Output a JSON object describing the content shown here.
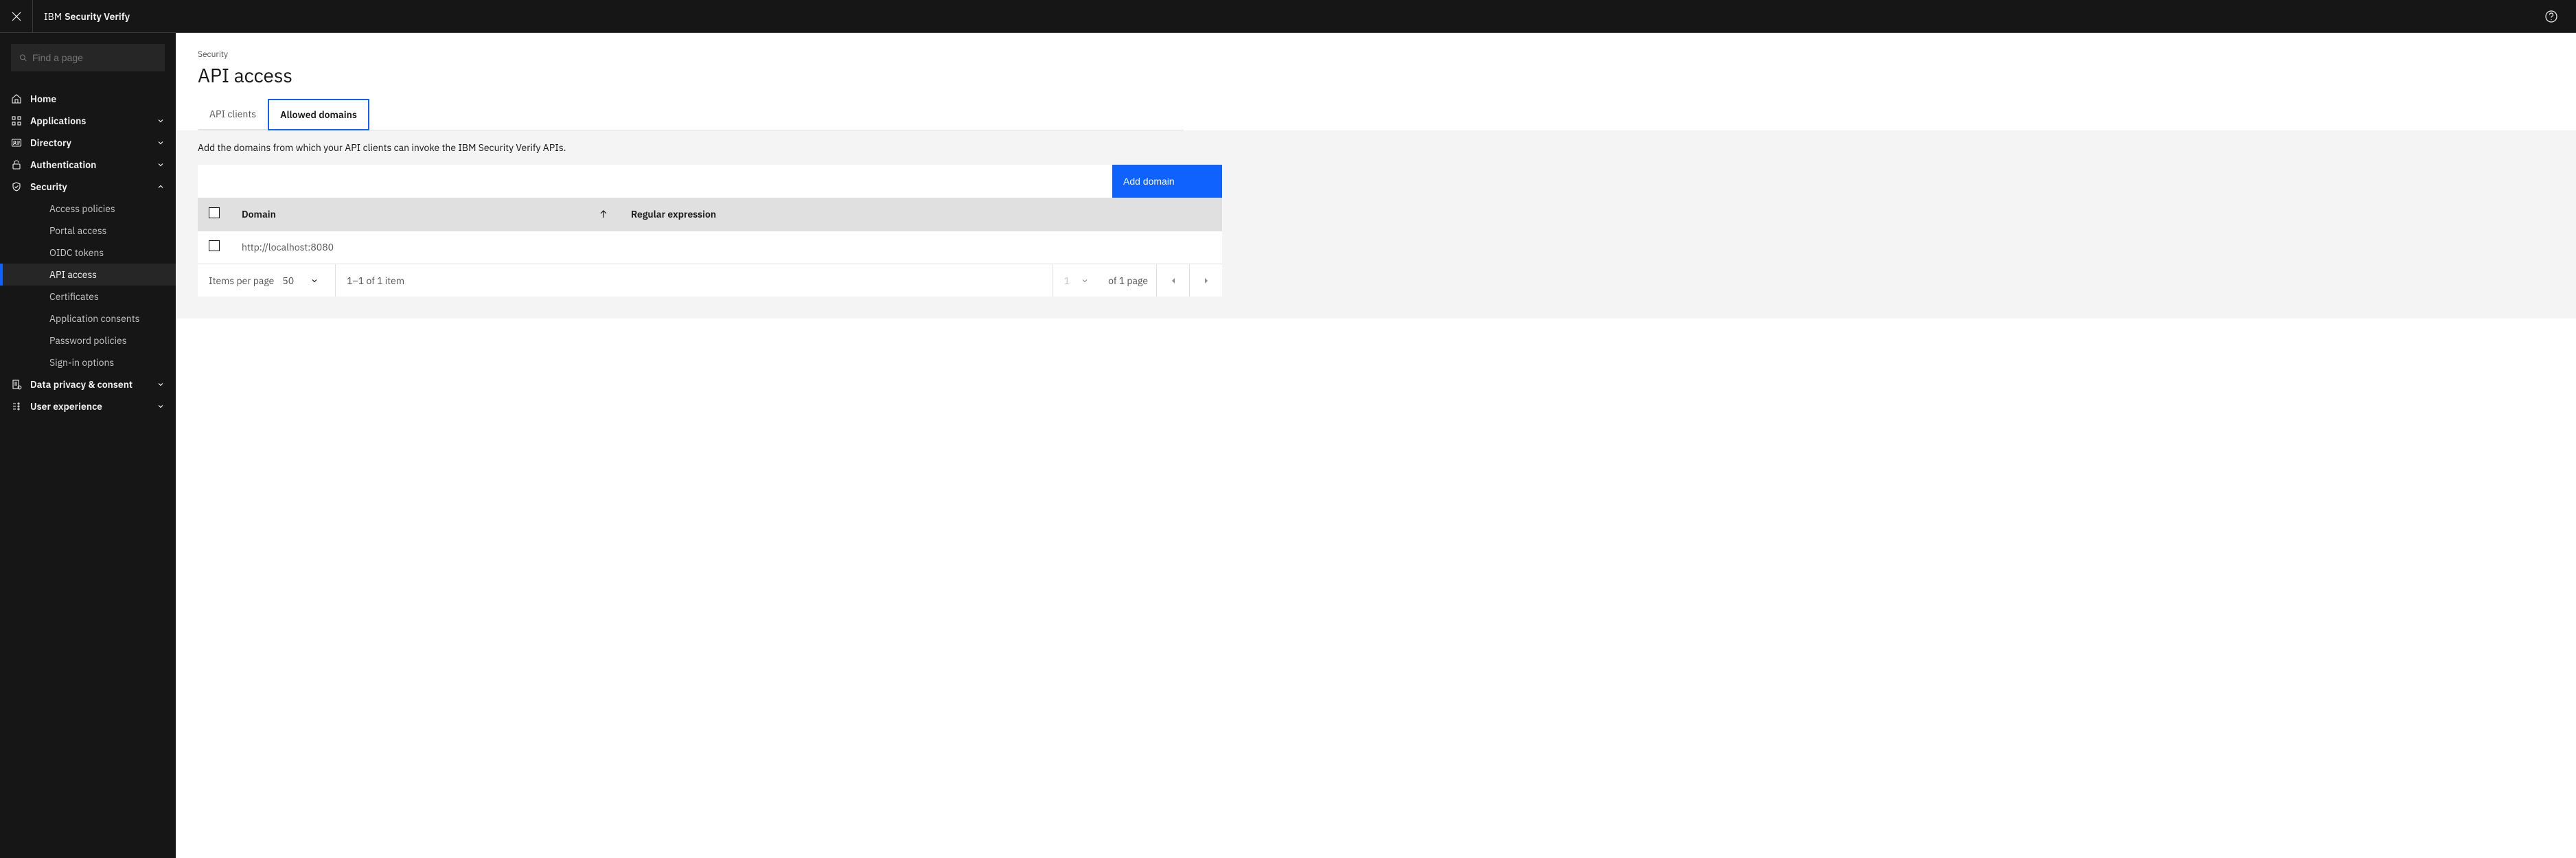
{
  "header": {
    "brand_prefix": "IBM ",
    "brand_name": "Security Verify"
  },
  "sidebar": {
    "search_placeholder": "Find a page",
    "items": [
      {
        "label": "Home",
        "icon": "home-icon",
        "expandable": false
      },
      {
        "label": "Applications",
        "icon": "apps-icon",
        "expandable": true
      },
      {
        "label": "Directory",
        "icon": "id-icon",
        "expandable": true
      },
      {
        "label": "Authentication",
        "icon": "lock-open-icon",
        "expandable": true
      },
      {
        "label": "Security",
        "icon": "shield-icon",
        "expandable": true,
        "expanded": true,
        "children": [
          {
            "label": "Access policies"
          },
          {
            "label": "Portal access"
          },
          {
            "label": "OIDC tokens"
          },
          {
            "label": "API access",
            "active": true
          },
          {
            "label": "Certificates"
          },
          {
            "label": "Application consents"
          },
          {
            "label": "Password policies"
          },
          {
            "label": "Sign-in options"
          }
        ]
      },
      {
        "label": "Data privacy & consent",
        "icon": "policy-icon",
        "expandable": true
      },
      {
        "label": "User experience",
        "icon": "ux-icon",
        "expandable": true
      }
    ]
  },
  "page": {
    "breadcrumb": "Security",
    "title": "API access",
    "tabs": [
      {
        "label": "API clients",
        "active": false
      },
      {
        "label": "Allowed domains",
        "active": true
      }
    ],
    "description": "Add the domains from which your API clients can invoke the IBM Security Verify APIs.",
    "add_button": "Add domain",
    "table": {
      "columns": {
        "domain": "Domain",
        "regex": "Regular expression"
      },
      "rows": [
        {
          "domain": "http://localhost:8080",
          "regex": ""
        }
      ]
    },
    "pagination": {
      "items_per_page_label": "Items per page",
      "page_size": "50",
      "range_text": "1–1 of 1 item",
      "current_page": "1",
      "of_pages_text": "of 1 page"
    }
  }
}
